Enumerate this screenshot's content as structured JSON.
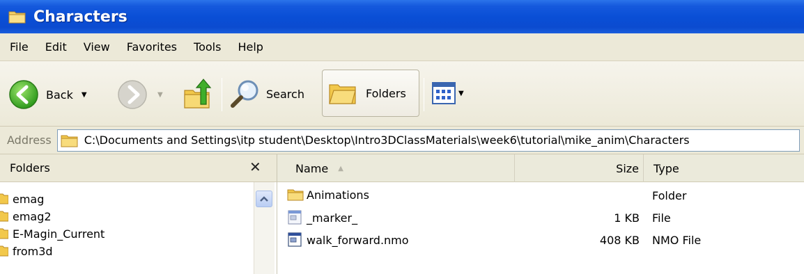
{
  "window": {
    "title": "Characters"
  },
  "menu": {
    "items": [
      "File",
      "Edit",
      "View",
      "Favorites",
      "Tools",
      "Help"
    ]
  },
  "toolbar": {
    "back_label": "Back",
    "search_label": "Search",
    "folders_label": "Folders"
  },
  "address": {
    "label": "Address",
    "path": "C:\\Documents and Settings\\itp student\\Desktop\\Intro3DClassMaterials\\week6\\tutorial\\mike_anim\\Characters"
  },
  "folders_pane": {
    "title": "Folders",
    "items": [
      "emag",
      "emag2",
      "E-Magin_Current",
      "from3d"
    ]
  },
  "file_list": {
    "columns": {
      "name": "Name",
      "size": "Size",
      "type": "Type"
    },
    "rows": [
      {
        "name": "Animations",
        "size": "",
        "type": "Folder",
        "icon": "folder-icon"
      },
      {
        "name": "_marker_",
        "size": "1 KB",
        "type": "File",
        "icon": "file-icon"
      },
      {
        "name": "walk_forward.nmo",
        "size": "408 KB",
        "type": "NMO File",
        "icon": "nmo-file-icon"
      }
    ]
  },
  "colors": {
    "titlebar": "#0a4fd6",
    "chrome": "#ece9d8",
    "folder": "#f2c84b"
  }
}
